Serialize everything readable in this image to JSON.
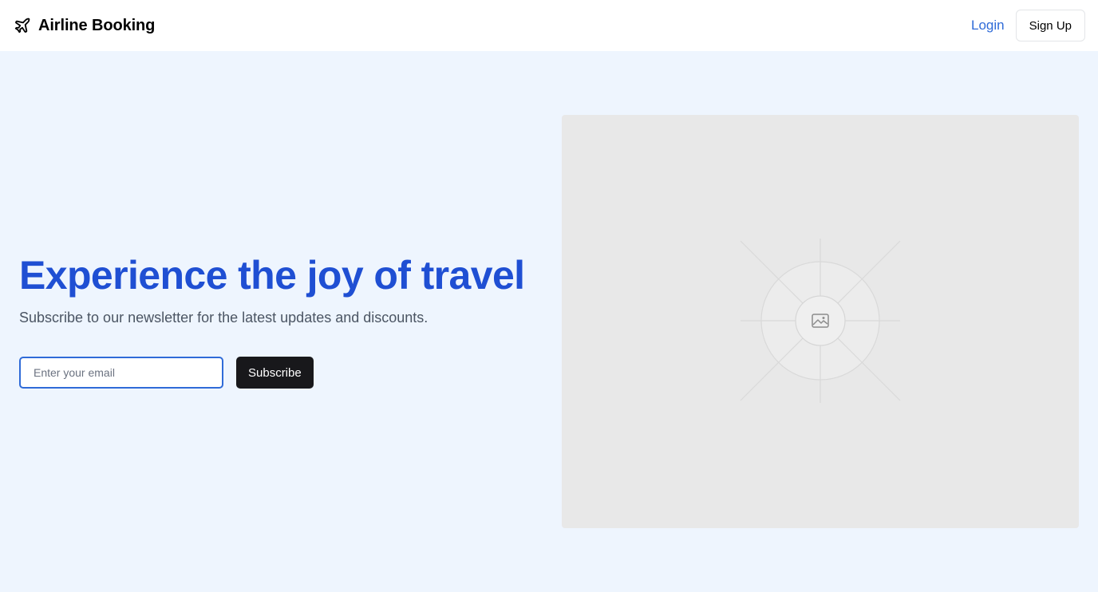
{
  "header": {
    "brand_name": "Airline Booking",
    "brand_icon": "plane-icon",
    "login_label": "Login",
    "signup_label": "Sign Up"
  },
  "hero": {
    "title": "Experience the joy of travel",
    "subtitle": "Subscribe to our newsletter for the latest updates and discounts.",
    "email_placeholder": "Enter your email",
    "email_value": "",
    "subscribe_label": "Subscribe",
    "image_icon": "image-placeholder-icon"
  },
  "colors": {
    "page_background": "#eef5fe",
    "title_blue": "#1f4fd3",
    "link_blue": "#2f6bd8",
    "button_dark": "#18181b",
    "placeholder_gray": "#e8e8e8"
  }
}
